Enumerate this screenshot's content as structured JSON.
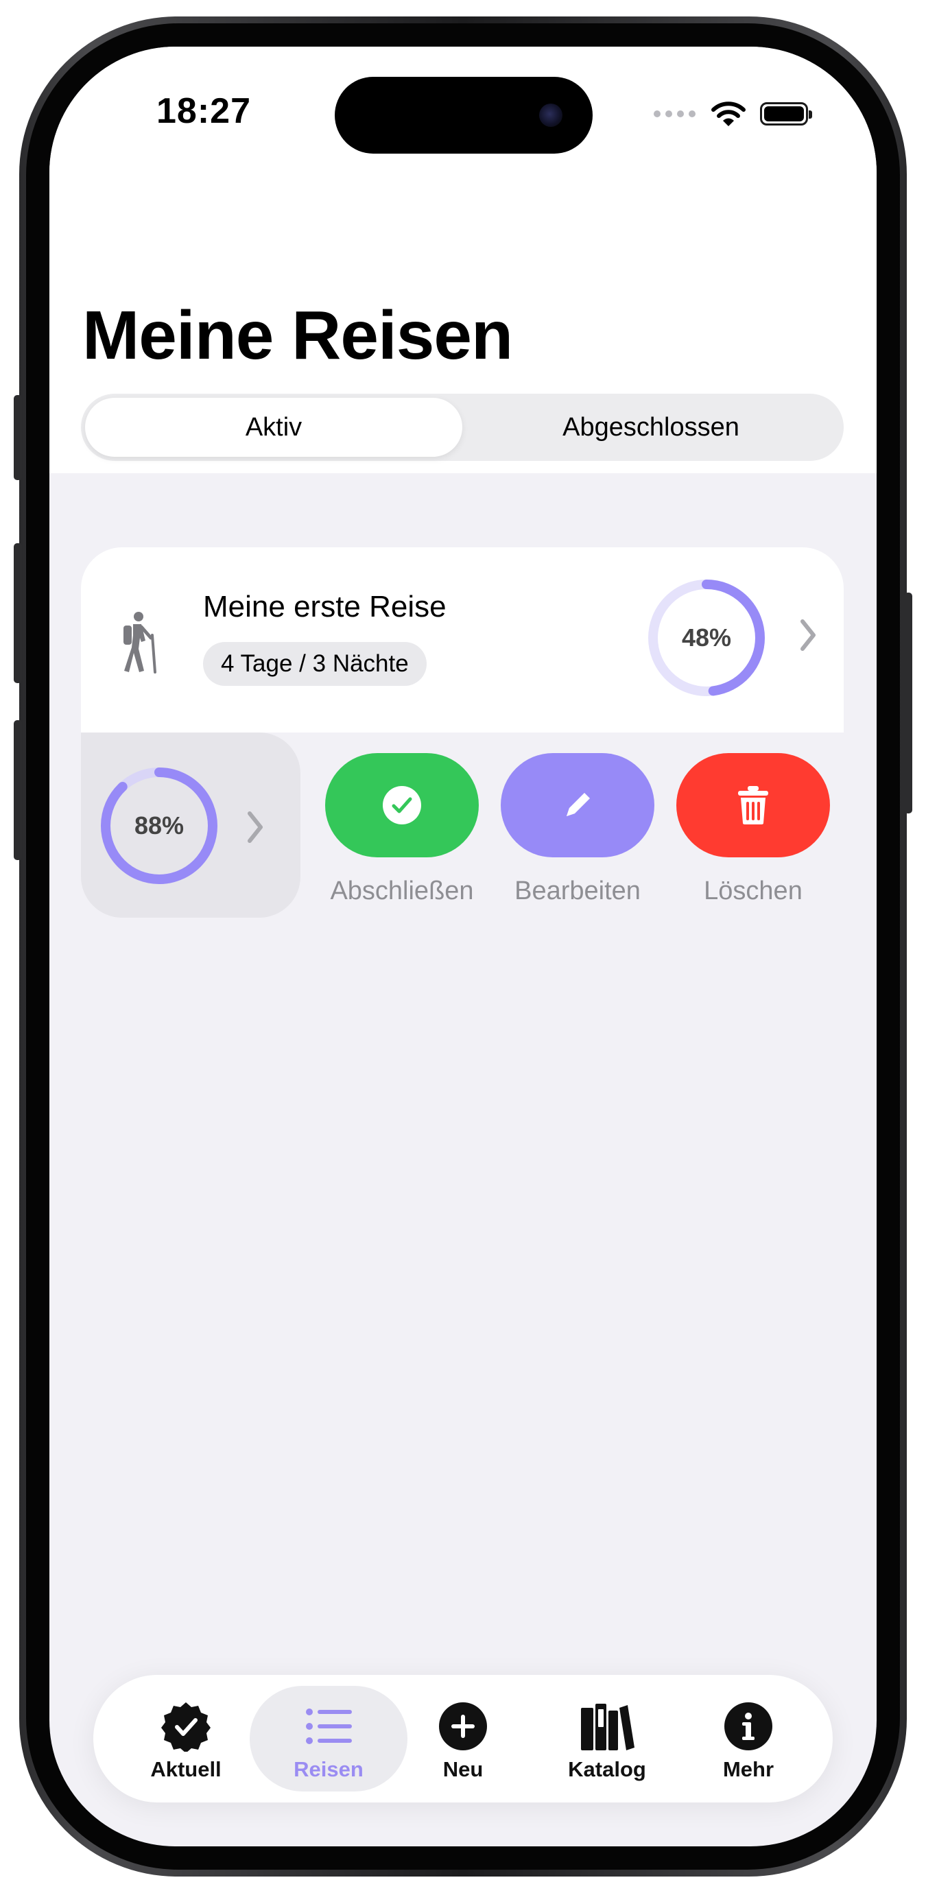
{
  "status_bar": {
    "time": "18:27"
  },
  "header": {
    "title": "Meine Reisen"
  },
  "segments": [
    {
      "label": "Aktiv",
      "selected": true
    },
    {
      "label": "Abgeschlossen",
      "selected": false
    }
  ],
  "trip": {
    "name": "Meine erste Reise",
    "duration": "4 Tage / 3 Nächte",
    "progress_label": "48%",
    "progress": 0.48
  },
  "swipe_peek": {
    "progress_label": "88%",
    "progress": 0.88
  },
  "actions": [
    {
      "label": "Abschließen",
      "icon": "checkmark-circle-icon",
      "color": "#34c759"
    },
    {
      "label": "Bearbeiten",
      "icon": "pencil-icon",
      "color": "#978af7"
    },
    {
      "label": "Löschen",
      "icon": "trash-icon",
      "color": "#ff3b30"
    }
  ],
  "tabs": [
    {
      "label": "Aktuell",
      "icon": "checkmark-seal-icon",
      "active": false
    },
    {
      "label": "Reisen",
      "icon": "list-icon",
      "active": true
    },
    {
      "label": "Neu",
      "icon": "plus-circle-icon",
      "active": false
    },
    {
      "label": "Katalog",
      "icon": "books-icon",
      "active": false
    },
    {
      "label": "Mehr",
      "icon": "info-circle-icon",
      "active": false
    }
  ],
  "colors": {
    "accent": "#978af7",
    "accent_track": "#e5e2fb",
    "success": "#34c759",
    "destructive": "#ff3b30",
    "background": "#f2f1f6"
  }
}
